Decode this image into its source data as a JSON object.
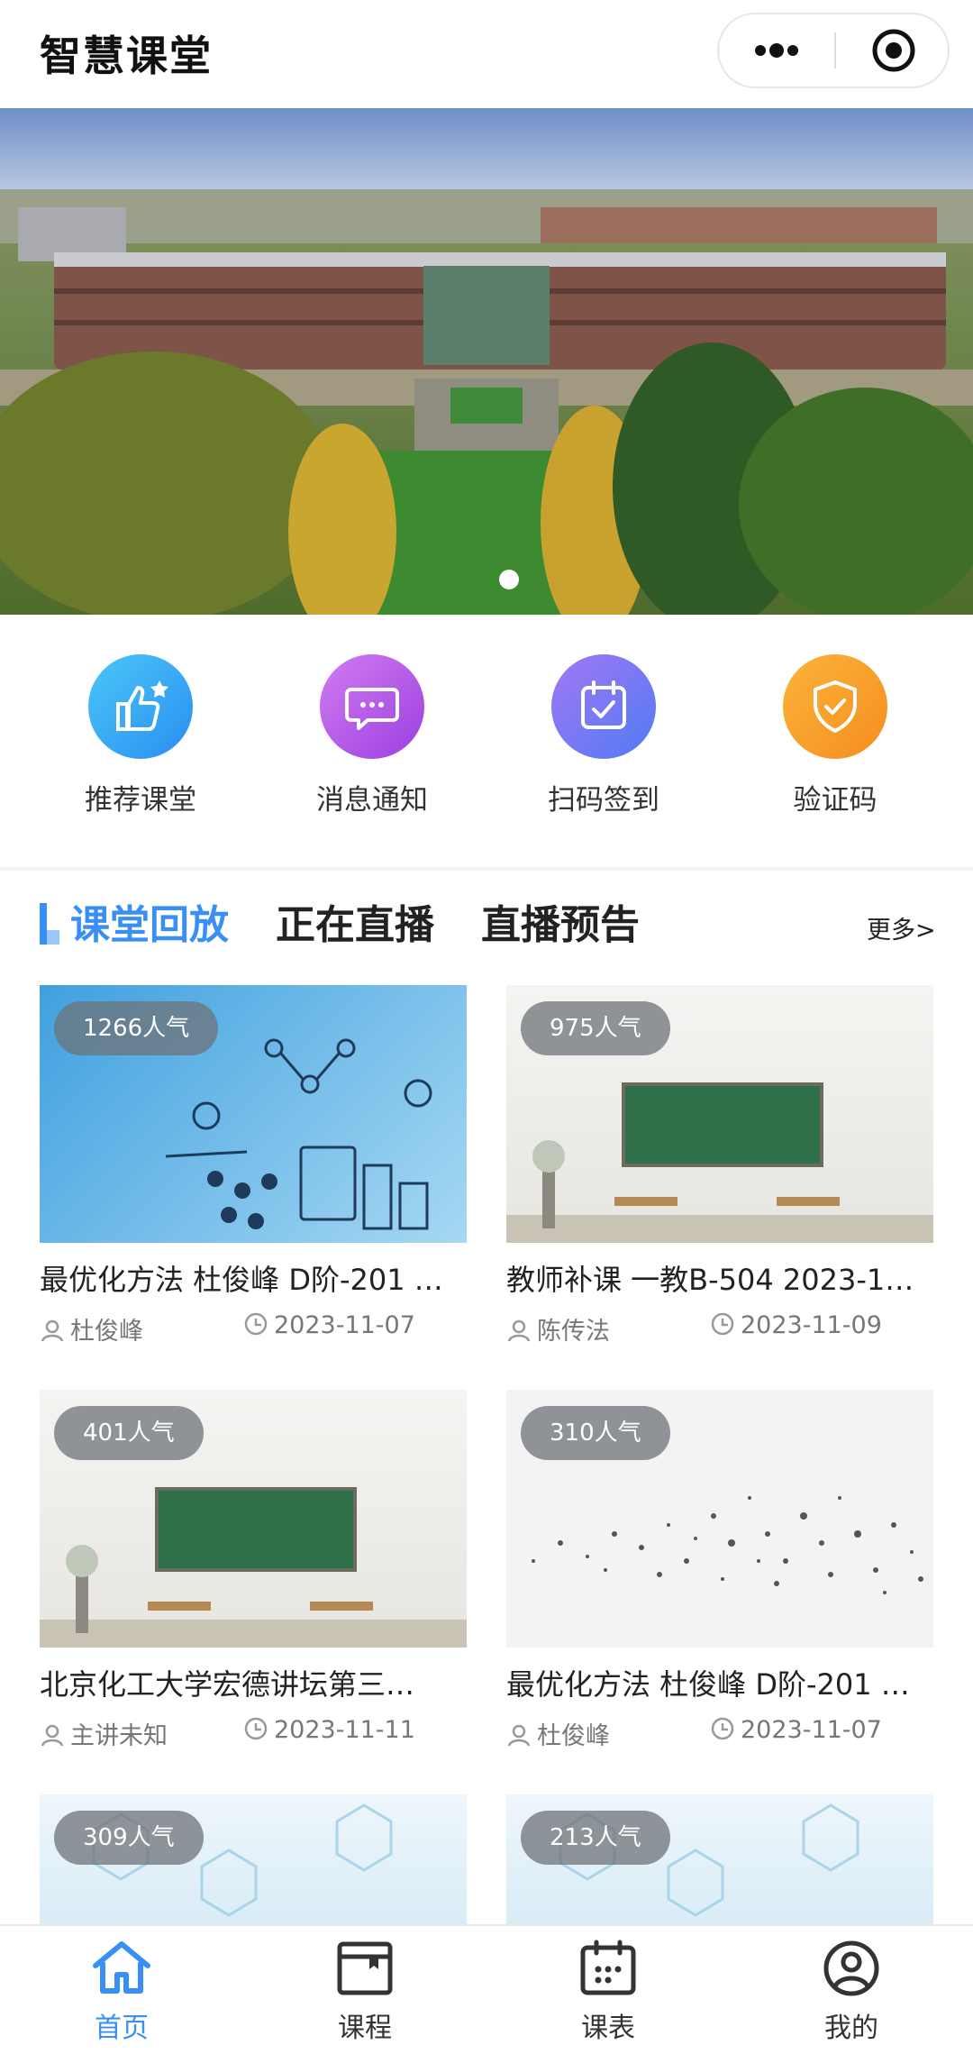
{
  "nav": {
    "title": "智慧课堂"
  },
  "quick": [
    {
      "label": "推荐课堂",
      "icon": "thumbs-up-icon"
    },
    {
      "label": "消息通知",
      "icon": "message-icon"
    },
    {
      "label": "扫码签到",
      "icon": "calendar-check-icon"
    },
    {
      "label": "验证码",
      "icon": "shield-check-icon"
    }
  ],
  "tabs": [
    {
      "label": "课堂回放",
      "active": true
    },
    {
      "label": "正在直播",
      "active": false
    },
    {
      "label": "直播预告",
      "active": false
    }
  ],
  "more_label": "更多>",
  "cards": [
    {
      "popularity": "1266人气",
      "title": "最优化方法 杜俊峰 D阶-201 …",
      "teacher": "杜俊峰",
      "date": "2023-11-07"
    },
    {
      "popularity": "975人气",
      "title": "教师补课 一教B-504 2023-1…",
      "teacher": "陈传法",
      "date": "2023-11-09"
    },
    {
      "popularity": "401人气",
      "title": "北京化工大学宏德讲坛第三…",
      "teacher": "主讲未知",
      "date": "2023-11-11"
    },
    {
      "popularity": "310人气",
      "title": "最优化方法 杜俊峰 D阶-201 …",
      "teacher": "杜俊峰",
      "date": "2023-11-07"
    },
    {
      "popularity": "309人气"
    },
    {
      "popularity": "213人气"
    }
  ],
  "tabbar": [
    {
      "label": "首页",
      "icon": "home-icon",
      "active": true
    },
    {
      "label": "课程",
      "icon": "course-icon",
      "active": false
    },
    {
      "label": "课表",
      "icon": "schedule-icon",
      "active": false
    },
    {
      "label": "我的",
      "icon": "profile-icon",
      "active": false
    }
  ],
  "colors": {
    "accent": "#3a8ff6"
  }
}
